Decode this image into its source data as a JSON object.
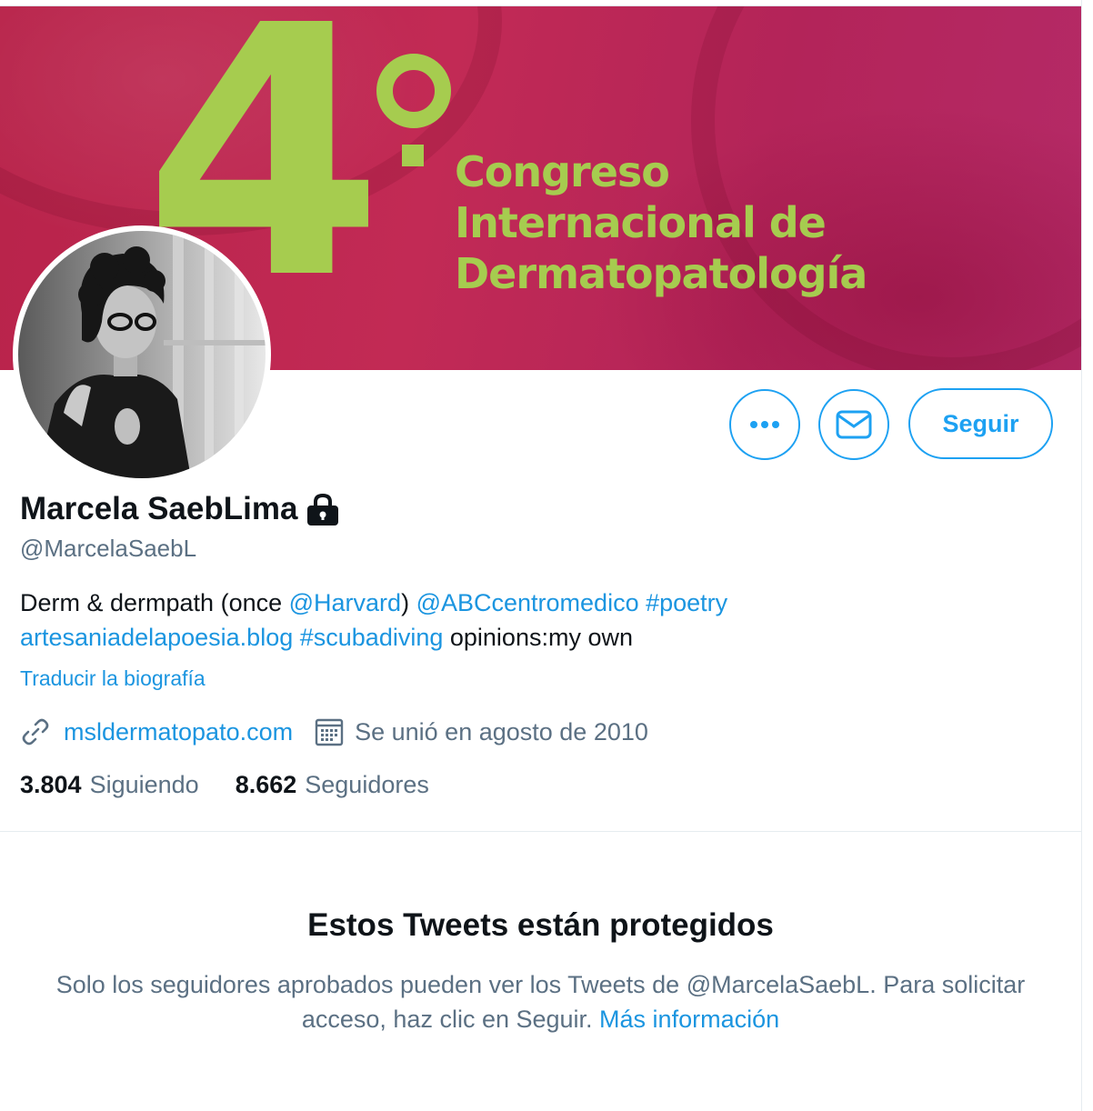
{
  "banner": {
    "number": "4",
    "lines": [
      "Congreso",
      "Internacional de",
      "Dermatopatología"
    ],
    "accent_color": "#a6cc4f",
    "background_color": "#bb2856"
  },
  "profile": {
    "name": "Marcela SaebLima",
    "lock_icon": "lock-icon",
    "handle": "@MarcelaSaebL",
    "bio": {
      "line1": [
        {
          "text": "Derm & dermpath (once ",
          "link": false
        },
        {
          "text": "@Harvard",
          "link": true
        },
        {
          "text": ") ",
          "link": false
        },
        {
          "text": "@ABCcentromedico",
          "link": true
        },
        {
          "text": " ",
          "link": false
        },
        {
          "text": "#poetry",
          "link": true
        }
      ],
      "line2": [
        {
          "text": "artesaniadelapoesia.blog",
          "link": true
        },
        {
          "text": " ",
          "link": false
        },
        {
          "text": "#scubadiving",
          "link": true
        },
        {
          "text": " opinions:my own",
          "link": false
        }
      ]
    },
    "translate_label": "Traducir la biografía",
    "website": "msldermatopato.com",
    "joined": "Se unió en agosto de 2010",
    "following_count": "3.804",
    "following_label": "Siguiendo",
    "followers_count": "8.662",
    "followers_label": "Seguidores"
  },
  "actions": {
    "more_icon": "more-icon",
    "message_icon": "envelope-icon",
    "follow_label": "Seguir",
    "accent_color": "#1da1f2"
  },
  "protected": {
    "title": "Estos Tweets están protegidos",
    "text": "Solo los seguidores aprobados pueden ver los Tweets de @MarcelaSaebL. Para solicitar acceso, haz clic en Seguir. ",
    "link_label": "Más información"
  }
}
